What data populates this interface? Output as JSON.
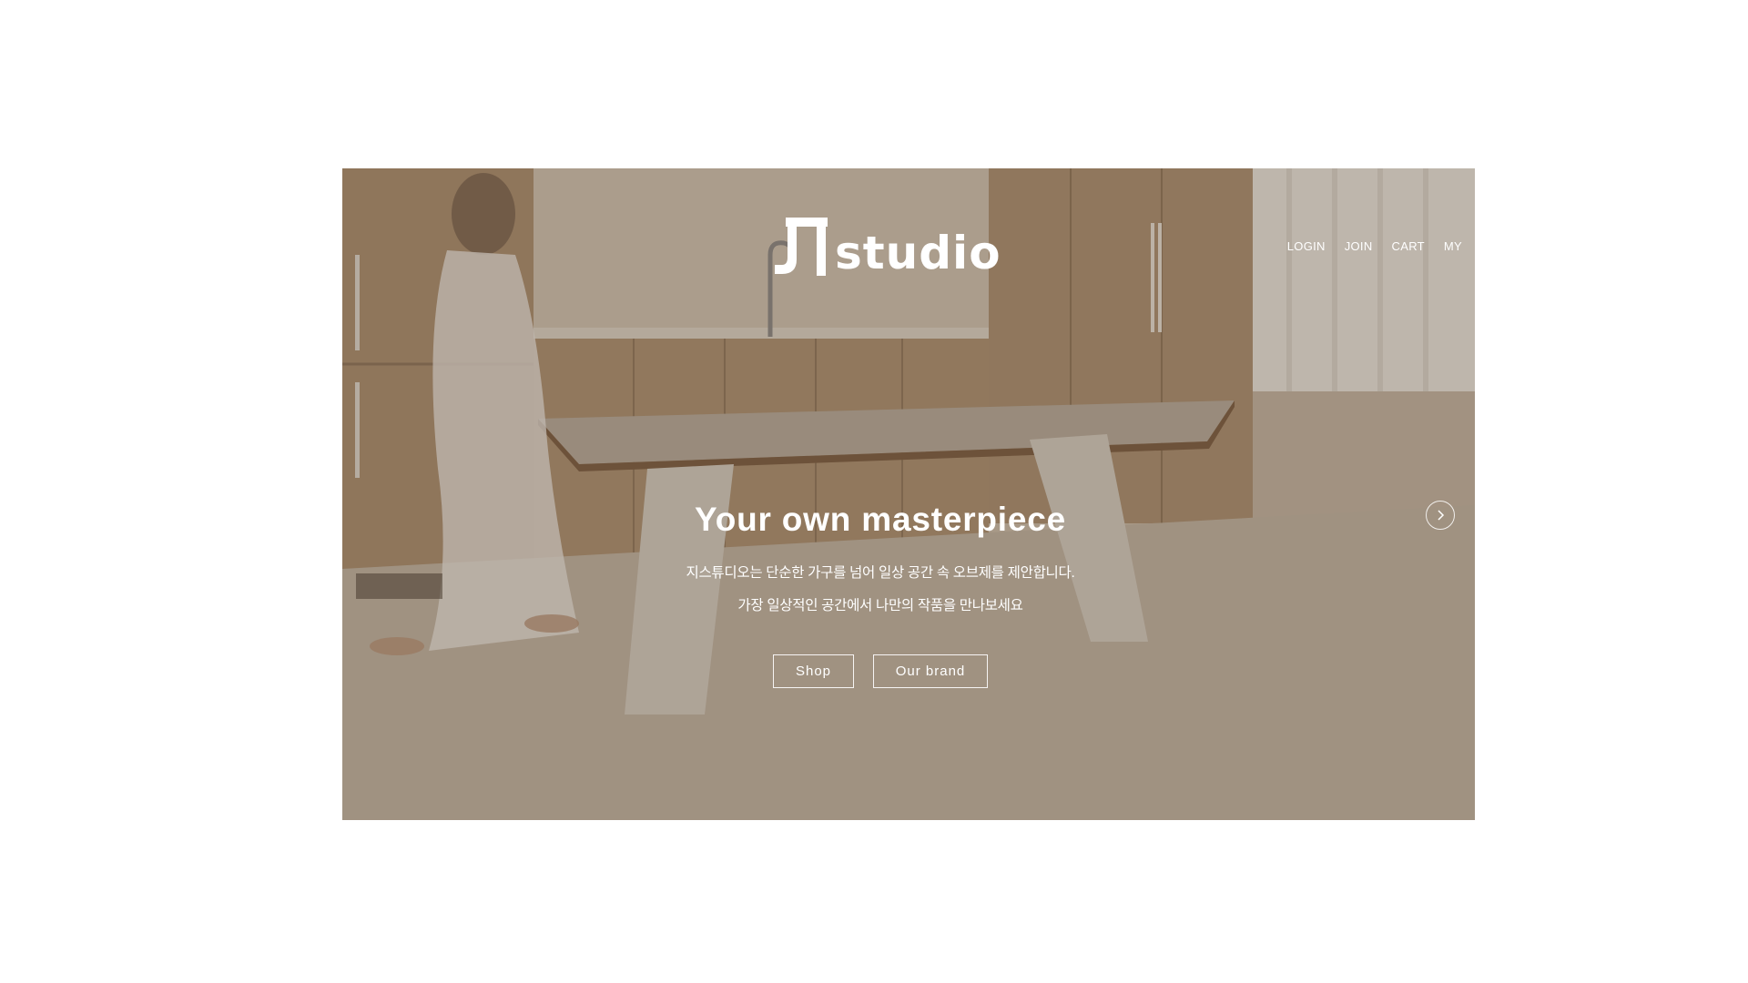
{
  "brand": {
    "logo_text": "studio",
    "logo_mark_icon": "ji-monogram-icon"
  },
  "nav": {
    "items": [
      {
        "label": "LOGIN"
      },
      {
        "label": "JOIN"
      },
      {
        "label": "CART"
      },
      {
        "label": "MY"
      }
    ]
  },
  "hero": {
    "headline": "Your own masterpiece",
    "description_line1": "지스튜디오는 단순한 가구를 넘어 일상 공간 속 오브제를 제안합니다.",
    "description_line2": "가장 일상적인 공간에서 나만의 작품을 만나보세요",
    "buttons": {
      "shop": "Shop",
      "brand": "Our brand"
    },
    "next_icon": "chevron-right-icon"
  },
  "colors": {
    "text": "#ffffff",
    "page_bg": "#ffffff"
  }
}
